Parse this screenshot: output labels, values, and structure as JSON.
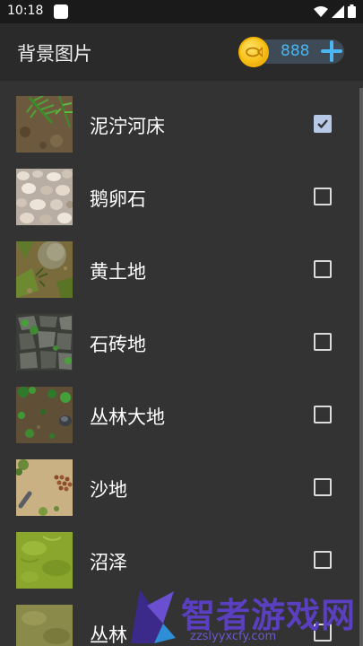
{
  "status": {
    "time": "10:18"
  },
  "header": {
    "title": "背景图片",
    "coins": "888",
    "icons": {
      "coin": "fish-coin-icon",
      "add": "plus-icon"
    }
  },
  "colors": {
    "accent": "#49b7f2",
    "checked": "#b7c9e6",
    "watermark": "#5a3fc0"
  },
  "backgrounds": [
    {
      "label": "泥泞河床",
      "checked": true
    },
    {
      "label": "鹅卵石",
      "checked": false
    },
    {
      "label": "黄土地",
      "checked": false
    },
    {
      "label": "石砖地",
      "checked": false
    },
    {
      "label": "丛林大地",
      "checked": false
    },
    {
      "label": "沙地",
      "checked": false
    },
    {
      "label": "沼泽",
      "checked": false
    },
    {
      "label": "丛林",
      "checked": false
    }
  ],
  "watermark": {
    "title": "智者游戏网",
    "url": "zzslyyxcfy.com"
  }
}
